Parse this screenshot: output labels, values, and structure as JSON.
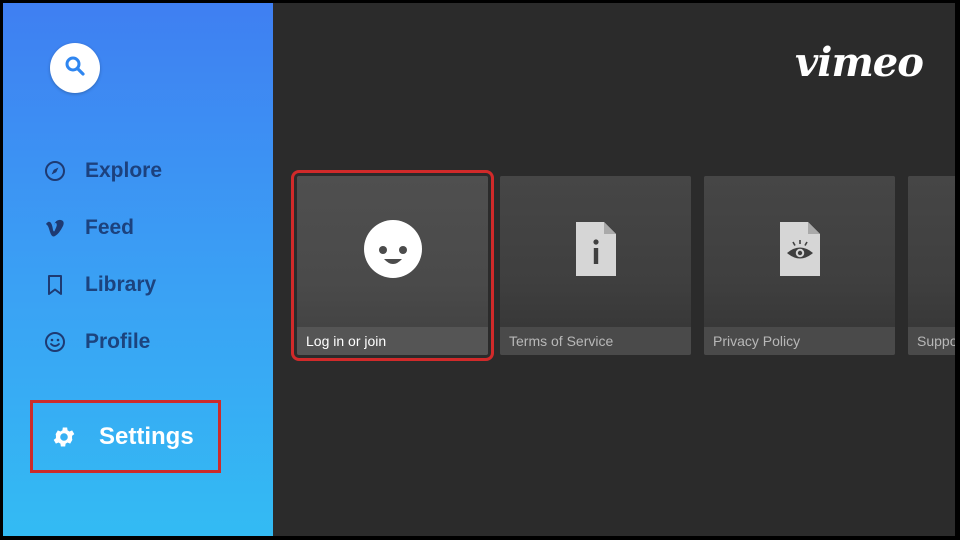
{
  "sidebar": {
    "search_icon": "search-icon",
    "items": [
      {
        "label": "Explore",
        "icon": "compass-icon"
      },
      {
        "label": "Feed",
        "icon": "vimeo-v-icon"
      },
      {
        "label": "Library",
        "icon": "bookmark-icon"
      },
      {
        "label": "Profile",
        "icon": "smiley-icon"
      }
    ],
    "settings": {
      "label": "Settings",
      "icon": "gear-icon",
      "selected": true
    }
  },
  "header": {
    "logo_text": "vimeo"
  },
  "cards": [
    {
      "label": "Log in or join",
      "icon": "face-icon",
      "selected": true
    },
    {
      "label": "Terms of Service",
      "icon": "document-info-icon",
      "selected": false
    },
    {
      "label": "Privacy Policy",
      "icon": "document-eye-icon",
      "selected": false
    },
    {
      "label": "Suppo",
      "icon": "",
      "selected": false
    }
  ],
  "colors": {
    "sidebar_top": "#3f7ff2",
    "sidebar_bottom": "#33bbf3",
    "background": "#2b2b2b",
    "focus_outline": "#d12a2a"
  }
}
